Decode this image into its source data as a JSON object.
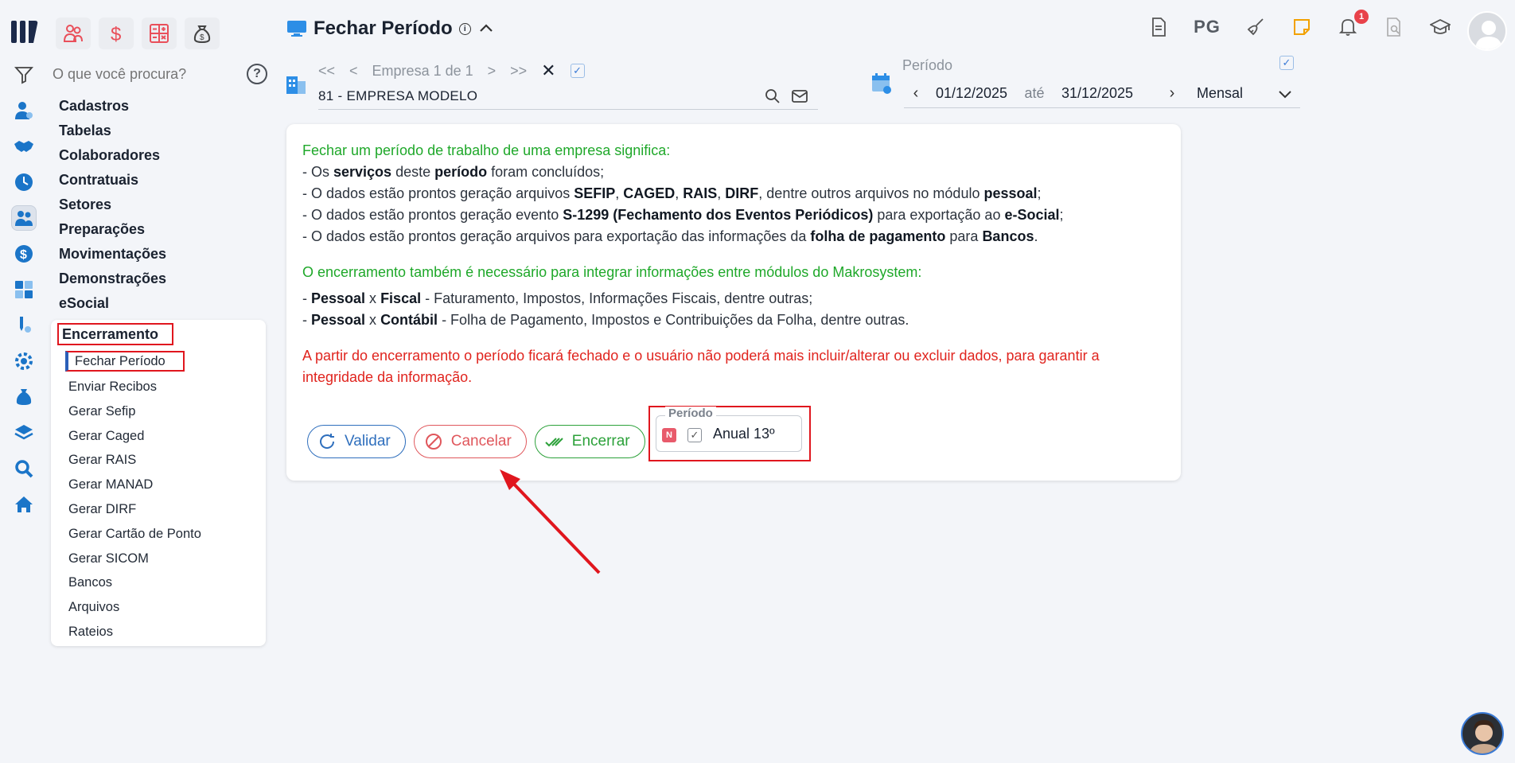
{
  "header": {
    "title": "Fechar Período"
  },
  "search": {
    "placeholder": "O que você procura?"
  },
  "menu": {
    "items": [
      "Cadastros",
      "Tabelas",
      "Colaboradores",
      "Contratuais",
      "Setores",
      "Preparações",
      "Movimentações",
      "Demonstrações",
      "eSocial"
    ],
    "section": "Encerramento",
    "subitems": [
      "Fechar Período",
      "Enviar Recibos",
      "Gerar Sefip",
      "Gerar Caged",
      "Gerar RAIS",
      "Gerar MANAD",
      "Gerar DIRF",
      "Gerar Cartão de Ponto",
      "Gerar SICOM",
      "Bancos",
      "Arquivos",
      "Rateios"
    ]
  },
  "toolbar": {
    "pg_label": "PG",
    "notification_count": "1"
  },
  "company_nav": {
    "first": "<<",
    "prev": "<",
    "label": "Empresa 1 de 1",
    "next": ">",
    "last": ">>",
    "close": "✕",
    "company": "81 - EMPRESA MODELO"
  },
  "period": {
    "label": "Período",
    "start": "01/12/2025",
    "between": "até",
    "end": "31/12/2025",
    "mode": "Mensal"
  },
  "content": {
    "intro": "Fechar um período de trabalho de uma empresa significa:",
    "line1_a": "- Os ",
    "line1_b": "serviços",
    "line1_c": " deste ",
    "line1_d": "período",
    "line1_e": " foram concluídos;",
    "line2_a": "- O dados estão prontos geração arquivos ",
    "line2_b": "SEFIP",
    "line2_c": ", ",
    "line2_d": "CAGED",
    "line2_e": ", ",
    "line2_f": "RAIS",
    "line2_g": ", ",
    "line2_h": "DIRF",
    "line2_i": ", dentre outros arquivos no módulo ",
    "line2_j": "pessoal",
    "line2_k": ";",
    "line3_a": "- O dados estão prontos geração evento ",
    "line3_b": "S-1299 (Fechamento dos Eventos Periódicos)",
    "line3_c": " para exportação ao ",
    "line3_d": "e-Social",
    "line3_e": ";",
    "line4_a": "- O dados estão prontos geração arquivos para exportação das informações da ",
    "line4_b": "folha de pagamento",
    "line4_c": " para ",
    "line4_d": "Bancos",
    "line4_e": ".",
    "integration": "O encerramento também é necessário para integrar informações entre módulos do Makrosystem:",
    "int1_a": "- ",
    "int1_b": "Pessoal",
    "int1_c": " x ",
    "int1_d": "Fiscal",
    "int1_e": " - Faturamento, Impostos, Informações Fiscais, dentre outras;",
    "int2_a": "- ",
    "int2_b": "Pessoal",
    "int2_c": " x ",
    "int2_d": "Contábil",
    "int2_e": " - Folha de Pagamento, Impostos e Contribuições da Folha, dentre outras.",
    "warning": "A partir do encerramento o período ficará fechado e o usuário não poderá mais incluir/alterar ou excluir dados, para garantir a integridade da informação."
  },
  "actions": {
    "validar": "Validar",
    "cancelar": "Cancelar",
    "encerrar": "Encerrar"
  },
  "periodo_group": {
    "legend": "Período",
    "badge": "N",
    "option": "Anual 13º",
    "checked": true
  },
  "colors": {
    "brand_dark": "#1c2a4a",
    "accent_blue": "#2f6fbd",
    "green": "#1fa82a",
    "red": "#e0241e"
  }
}
